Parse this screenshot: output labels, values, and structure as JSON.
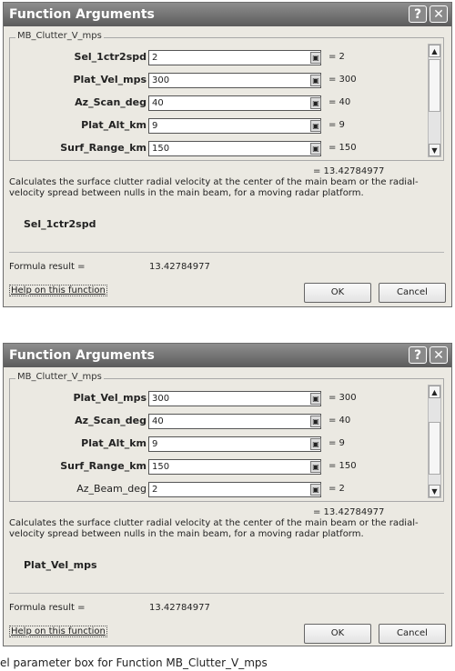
{
  "dialog1": {
    "title": "Function Arguments",
    "help_glyph": "?",
    "close_glyph": "✕",
    "group_label": "MB_Clutter_V_mps",
    "args": [
      {
        "label": "Sel_1ctr2spd",
        "value": "2",
        "result": "= 2"
      },
      {
        "label": "Plat_Vel_mps",
        "value": "300",
        "result": "= 300"
      },
      {
        "label": "Az_Scan_deg",
        "value": "40",
        "result": "= 40"
      },
      {
        "label": "Plat_Alt_km",
        "value": "9",
        "result": "= 9"
      },
      {
        "label": "Surf_Range_km",
        "value": "150",
        "result": "= 150"
      }
    ],
    "total_result": "= 13.42784977",
    "description": "Calculates the surface clutter radial velocity at the center of the main beam or the radial-velocity spread between nulls in the main beam, for a moving radar platform.",
    "selected_arg": "Sel_1ctr2spd",
    "formula_result_label": "Formula result =",
    "formula_result_value": "13.42784977",
    "help_link": "Help on this function",
    "ok": "OK",
    "cancel": "Cancel"
  },
  "dialog2": {
    "title": "Function Arguments",
    "help_glyph": "?",
    "close_glyph": "✕",
    "group_label": "MB_Clutter_V_mps",
    "args": [
      {
        "label": "Plat_Vel_mps",
        "value": "300",
        "result": "= 300"
      },
      {
        "label": "Az_Scan_deg",
        "value": "40",
        "result": "= 40"
      },
      {
        "label": "Plat_Alt_km",
        "value": "9",
        "result": "= 9"
      },
      {
        "label": "Surf_Range_km",
        "value": "150",
        "result": "= 150"
      },
      {
        "label": "Az_Beam_deg",
        "value": "2",
        "result": "= 2"
      }
    ],
    "total_result": "= 13.42784977",
    "description": "Calculates the surface clutter radial velocity at the center of the main beam or the radial-velocity spread between nulls in the main beam, for a moving radar platform.",
    "selected_arg": "Plat_Vel_mps",
    "formula_result_label": "Formula result =",
    "formula_result_value": "13.42784977",
    "help_link": "Help on this function",
    "ok": "OK",
    "cancel": "Cancel"
  },
  "caption": "el parameter box for Function MB_Clutter_V_mps"
}
